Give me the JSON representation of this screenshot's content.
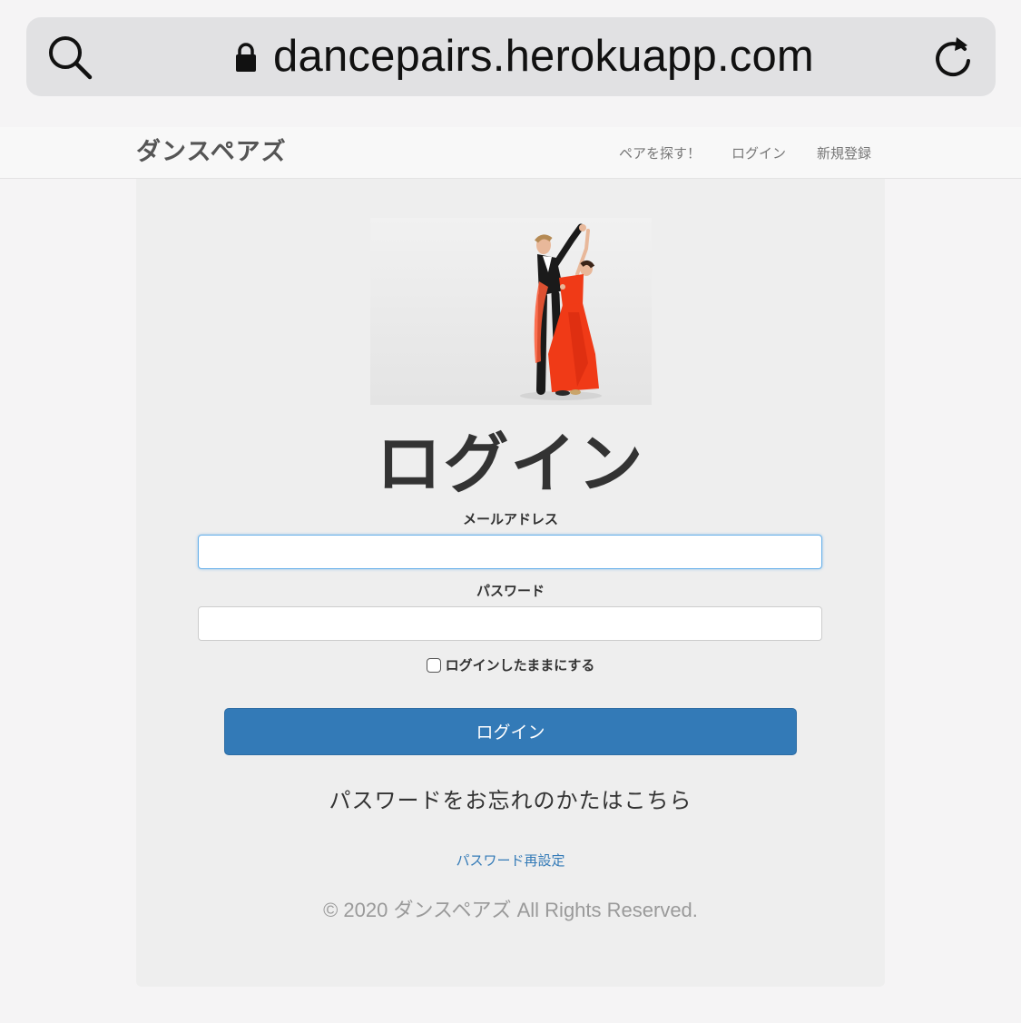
{
  "browser": {
    "url": "dancepairs.herokuapp.com"
  },
  "navbar": {
    "brand": "ダンスペアズ",
    "links": [
      {
        "label": "ペアを探す！"
      },
      {
        "label": "ログイン"
      },
      {
        "label": "新規登録"
      }
    ]
  },
  "login_form": {
    "title": "ログイン",
    "email_label": "メールアドレス",
    "email_value": "",
    "password_label": "パスワード",
    "password_value": "",
    "remember_label": "ログインしたままにする",
    "remember_checked": false,
    "submit_label": "ログイン"
  },
  "forgot": {
    "heading": "パスワードをお忘れのかたはこちら",
    "reset_link": "パスワード再設定"
  },
  "footer": {
    "copyright": "© 2020 ダンスペアズ All Rights Reserved."
  },
  "colors": {
    "primary": "#337ab7",
    "dress": "#f03a17",
    "page_bg": "#f5f4f5",
    "panel_bg": "#eeeeee"
  }
}
